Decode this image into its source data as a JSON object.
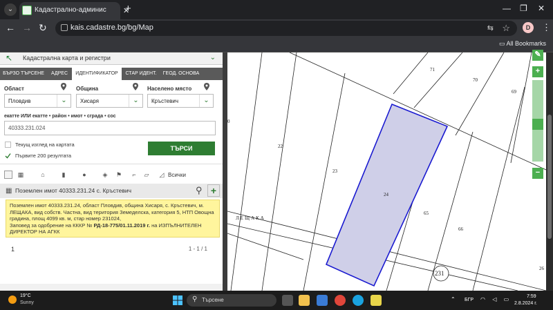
{
  "browser": {
    "tab_title": "Кадастрално-административна",
    "new_tab": "+",
    "url": "kais.cadastre.bg/bg/Map",
    "profile_initial": "D",
    "all_bookmarks": "All Bookmarks"
  },
  "app": {
    "title": "Кадастрална карта и регистри",
    "tabs": [
      "БЪРЗО ТЪРСЕНЕ",
      "АДРЕС",
      "ИДЕНТИФИКАТОР",
      "СТАР ИДЕНТ.",
      "ГЕОД. ОСНОВА"
    ],
    "active_tab": "ИДЕНТИФИКАТОР",
    "fields": {
      "oblast_label": "Област",
      "oblast_value": "Пловдив",
      "obshtina_label": "Община",
      "obshtina_value": "Хисаря",
      "naseleno_label": "Населено място",
      "naseleno_value": "Кръстевич"
    },
    "identifier_label": "екатте ИЛИ екатте • район • имот • сграда • сос",
    "identifier_value": "40333.231.024",
    "checkbox_current_view": "Текущ изглед на картата",
    "checkbox_first_200": "Първите 200 резултата",
    "search_button": "ТЪРСИ",
    "filter_all": "Всички",
    "result_title": "Поземлен имот 40333.231.24 с. Кръстевич",
    "result_text_1": "Поземлен имот 40333.231.24, област Пловдив, община Хисаря, с. Кръстевич, м. ЛЕЩАКА, вид собств. Частна, вид територия Земеделска, категория 5, НТП Овощна градина, площ 4099 кв. м, стар номер 231024,",
    "result_text_2a": "Заповед за одобрение на КККР № ",
    "result_text_2b": "РД-18-775/01.11.2019 г.",
    "result_text_2c": " на ИЗПЪЛНИТЕЛЕН ДИРЕКТОР НА АГКК",
    "page_num": "1",
    "page_count": "1 - 1 / 1"
  },
  "map": {
    "parcel_labels": [
      "71",
      "70",
      "69",
      "22",
      "23",
      "24",
      "65",
      "66",
      "26"
    ],
    "locality_label": "ЛЕЩАКА",
    "zone_label": "231",
    "edge_label": "0",
    "highlight_color": "#cfcfe8",
    "highlight_border": "#1a1ad0"
  },
  "taskbar": {
    "temp": "19°C",
    "weather": "Sunny",
    "search_placeholder": "Търсене",
    "lang": "БГР",
    "time": "7:59",
    "date": "2.8.2024 г."
  }
}
